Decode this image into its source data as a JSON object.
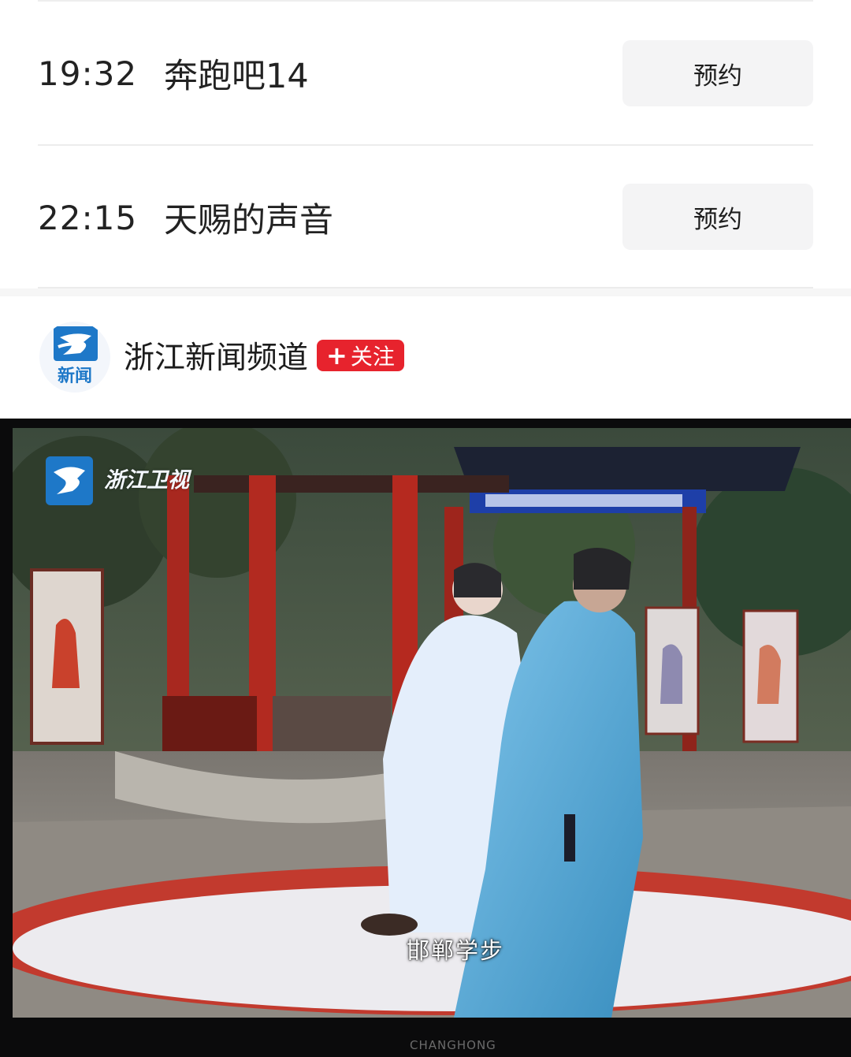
{
  "schedule": {
    "items": [
      {
        "time": "19:32",
        "title": "奔跑吧14",
        "action_label": "预约"
      },
      {
        "time": "22:15",
        "title": "天赐的声音",
        "action_label": "预约"
      }
    ]
  },
  "channel": {
    "avatar_text": "新闻",
    "name": "浙江新闻频道",
    "follow_label": "关注",
    "follow_plus": "+"
  },
  "video": {
    "station_logo_text": "浙江卫视",
    "subtitle": "邯郸学步",
    "tv_brand": "CHANGHONG"
  },
  "colors": {
    "accent_red": "#e7232d",
    "button_bg": "#f4f4f5",
    "logo_blue": "#1e78c8"
  }
}
